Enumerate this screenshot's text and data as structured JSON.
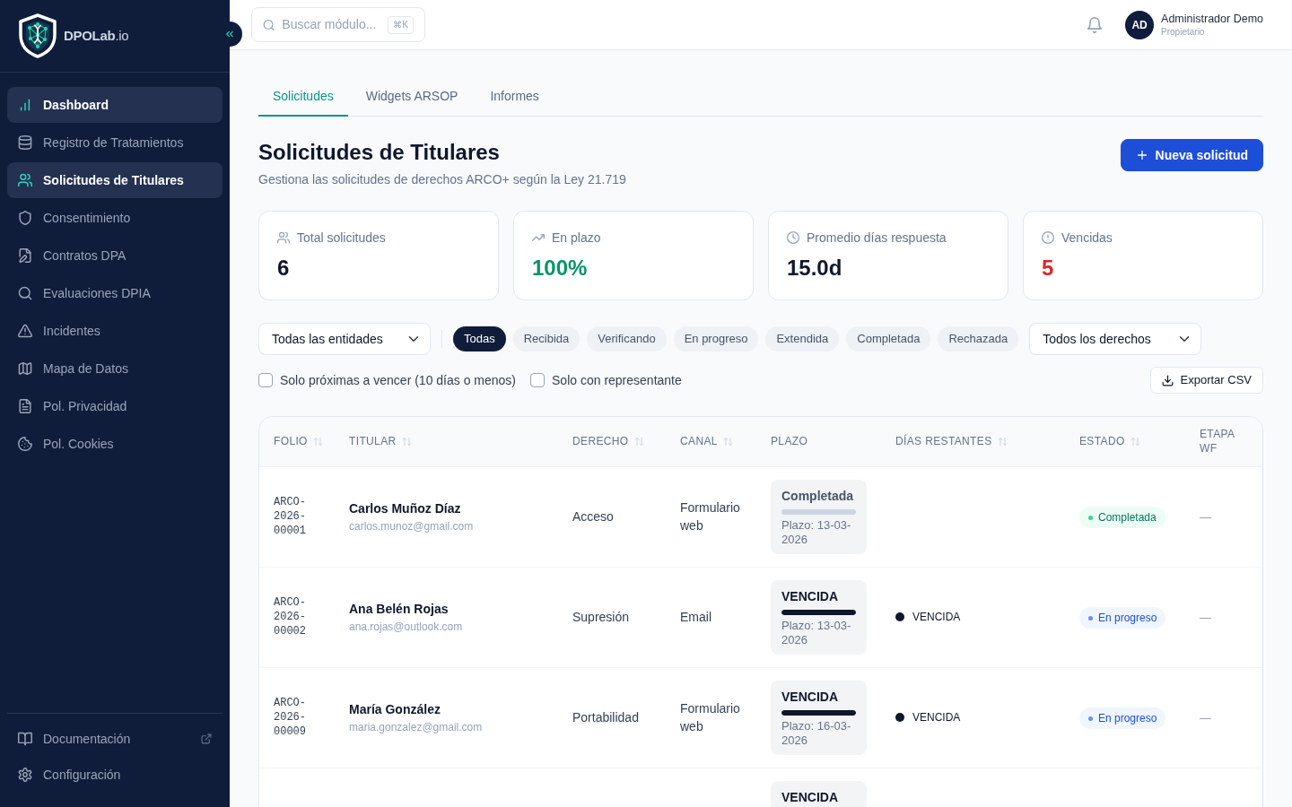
{
  "sidebar": {
    "logo": "**DPOLab**.io",
    "items": [
      {
        "label": "Dashboard",
        "selected": true
      },
      {
        "label": "Registro de Tratamientos",
        "selected": false
      },
      {
        "label": "Solicitudes de Titulares",
        "selected": true
      },
      {
        "label": "Consentimiento",
        "selected": false
      },
      {
        "label": "Contratos DPA",
        "selected": false
      },
      {
        "label": "Evaluaciones DPIA",
        "selected": false
      },
      {
        "label": "Incidentes",
        "selected": false
      },
      {
        "label": "Mapa de Datos",
        "selected": false
      },
      {
        "label": "Pol. Privacidad",
        "selected": false
      },
      {
        "label": "Pol. Cookies",
        "selected": false
      }
    ],
    "footer_items": [
      {
        "label": "Documentación",
        "external": true
      },
      {
        "label": "Configuración",
        "external": false
      }
    ]
  },
  "header": {
    "search": {
      "placeholder": "Buscar módulo...",
      "shortcut": "⌘K"
    },
    "user": {
      "initials": "AD",
      "name": "Administrador Demo",
      "role": "Propietario"
    }
  },
  "tabs": [
    {
      "label": "Solicitudes",
      "selected": true
    },
    {
      "label": "Widgets ARSOP",
      "selected": false
    },
    {
      "label": "Informes",
      "selected": false
    }
  ],
  "page": {
    "title": "Solicitudes de Titulares",
    "subtitle": "Gestiona las solicitudes de derechos ARCO+ según la Ley 21.719",
    "primary_action": "Nueva solicitud"
  },
  "stats": [
    {
      "label": "Total solicitudes",
      "value": "6",
      "color": "#0f172a"
    },
    {
      "label": "En plazo",
      "value": "100%",
      "color": "#059669"
    },
    {
      "label": "Promedio días respuesta",
      "value": "15.0d",
      "color": "#0f172a"
    },
    {
      "label": "Vencidas",
      "value": "5",
      "color": "#dc2626"
    }
  ],
  "filters": {
    "entity_select": "Todas las entidades",
    "status_pills": [
      {
        "label": "Todas",
        "selected": true
      },
      {
        "label": "Recibida",
        "selected": false
      },
      {
        "label": "Verificando",
        "selected": false
      },
      {
        "label": "En progreso",
        "selected": false
      },
      {
        "label": "Extendida",
        "selected": false
      },
      {
        "label": "Completada",
        "selected": false
      },
      {
        "label": "Rechazada",
        "selected": false
      }
    ],
    "rights_select": "Todos los derechos",
    "checkboxes": [
      {
        "label": "Solo próximas a vencer (10 días o menos)",
        "checked": false
      },
      {
        "label": "Solo con representante",
        "checked": false
      }
    ],
    "export_button": "Exportar CSV"
  },
  "table": {
    "columns": [
      {
        "label": "FOLIO",
        "sortable": true
      },
      {
        "label": "TITULAR",
        "sortable": true
      },
      {
        "label": "DERECHO",
        "sortable": true
      },
      {
        "label": "CANAL",
        "sortable": true
      },
      {
        "label": "PLAZO",
        "sortable": false
      },
      {
        "label": "DÍAS RESTANTES",
        "sortable": true
      },
      {
        "label": "ESTADO",
        "sortable": true
      },
      {
        "label": "ETAPA WF",
        "sortable": false
      }
    ],
    "rows": [
      {
        "folio": "ARCO-2026-00001",
        "titular": {
          "name": "Carlos Muñoz Díaz",
          "email": "carlos.munoz@gmail.com"
        },
        "derecho": "Acceso",
        "canal": "Formulario web",
        "plazo": {
          "status": "Completada",
          "kind": "done",
          "level": 1,
          "deadline": "Plazo: 13-03-2026"
        },
        "estado": {
          "label": "Completada",
          "kind": "completed"
        },
        "etapa_wf": "—"
      },
      {
        "folio": "ARCO-2026-00002",
        "titular": {
          "name": "Ana Belén Rojas",
          "email": "ana.rojas@outlook.com"
        },
        "derecho": "Supresión",
        "canal": "Email",
        "plazo": {
          "status": "VENCIDA",
          "kind": "overdue",
          "level": 1,
          "deadline": "Plazo: 13-03-2026"
        },
        "dias_restantes": "VENCIDA",
        "estado": {
          "label": "En progreso",
          "kind": "in_progress"
        },
        "etapa_wf": "—"
      },
      {
        "folio": "ARCO-2026-00009",
        "titular": {
          "name": "María González",
          "email": "maria.gonzalez@gmail.com"
        },
        "derecho": "Portabilidad",
        "canal": "Formulario web",
        "plazo": {
          "status": "VENCIDA",
          "kind": "overdue",
          "level": 1,
          "deadline": "Plazo: 16-03-2026"
        },
        "dias_restantes": "VENCIDA",
        "estado": {
          "label": "En progreso",
          "kind": "in_progress"
        },
        "etapa_wf": "—"
      },
      {
        "plazo": {
          "status": "VENCIDA",
          "kind": "overdue"
        }
      }
    ]
  }
}
